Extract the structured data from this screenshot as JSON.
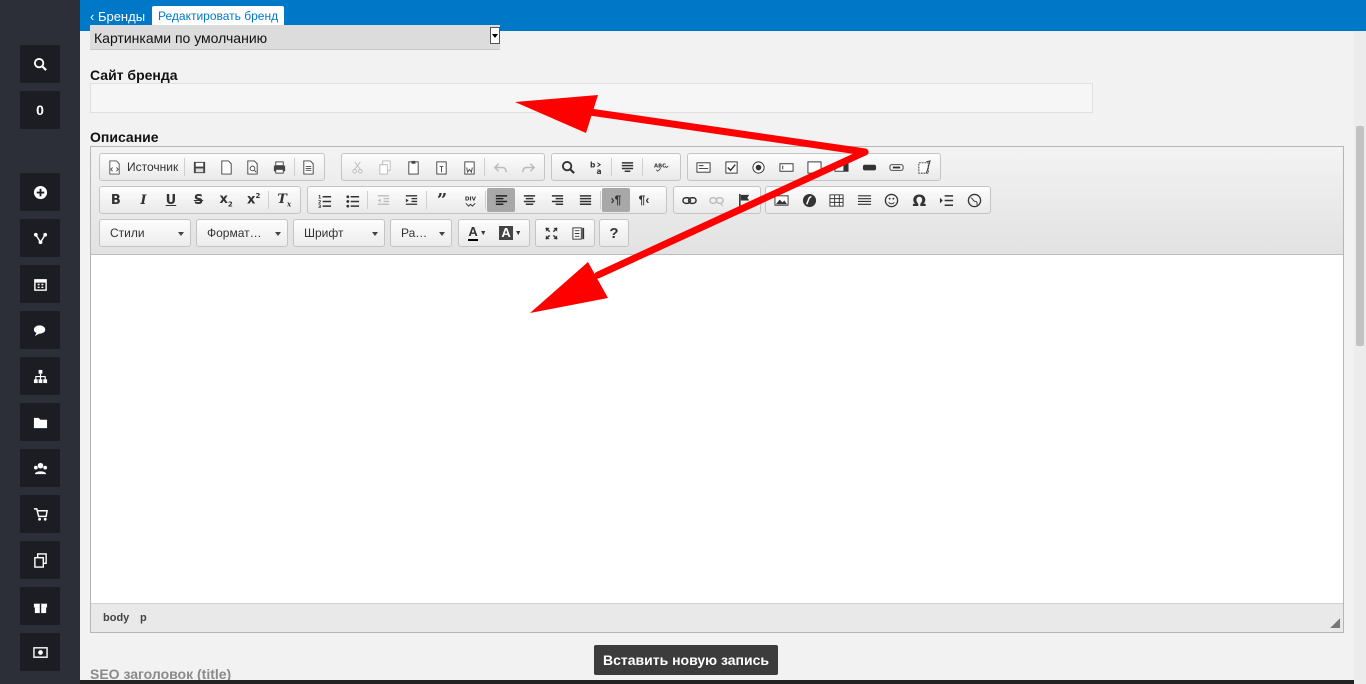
{
  "breadcrumb": {
    "back": "‹ Бренды",
    "current": "Редактировать бренд"
  },
  "sidebar": {
    "counter": "0",
    "items": [
      "search-icon",
      "plus-circle-icon",
      "sitemap-icon",
      "calendar-icon",
      "comments-icon",
      "hierarchy-icon",
      "folder-icon",
      "users-icon",
      "cart-icon",
      "copy-icon",
      "gift-icon",
      "money-icon"
    ]
  },
  "form": {
    "image_mode_value": "Картинками по умолчанию",
    "site_label": "Сайт бренда",
    "site_value": "",
    "description_label": "Описание",
    "seo_title_label": "SEO заголовок (title)",
    "insert_button": "Вставить новую запись"
  },
  "editor": {
    "source_label": "Источник",
    "styles_label": "Стили",
    "format_label": "Формат…",
    "font_label": "Шрифт",
    "size_label": "Ра…",
    "help_label": "?",
    "path": [
      "body",
      "p"
    ]
  },
  "annotation": {
    "arrow_color": "#ff0000"
  }
}
